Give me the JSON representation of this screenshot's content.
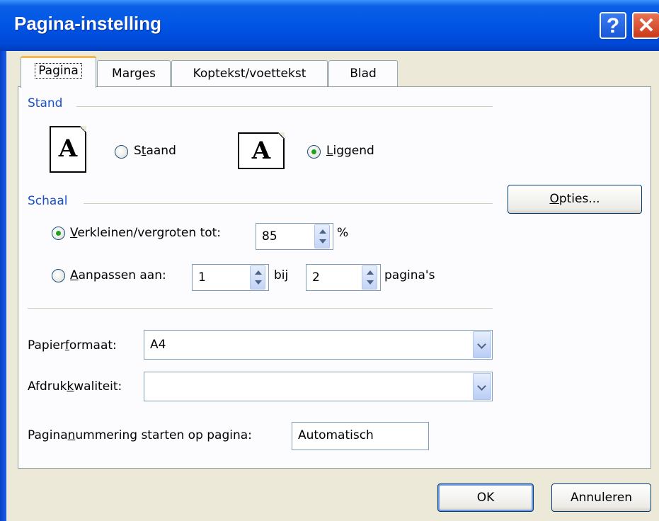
{
  "window": {
    "title": "Pagina-instelling",
    "help_glyph": "?",
    "close_glyph": "✕"
  },
  "tabs": [
    {
      "label": "Pagina",
      "active": true
    },
    {
      "label": "Marges"
    },
    {
      "label": "Koptekst/voettekst"
    },
    {
      "label": "Blad"
    }
  ],
  "stand": {
    "group_label": "Stand",
    "icon_letter": "A",
    "portrait": {
      "pre": "S",
      "u": "t",
      "post": "aand",
      "selected": false
    },
    "landscape": {
      "pre": "",
      "u": "L",
      "post": "iggend",
      "selected": true
    }
  },
  "schaal": {
    "group_label": "Schaal",
    "adjust": {
      "pre": "",
      "u": "V",
      "post": "erkleinen/vergroten tot:",
      "value": "85",
      "unit": "%",
      "selected": true
    },
    "fit": {
      "pre": "",
      "u": "A",
      "post": "anpassen aan:",
      "wide": "1",
      "bij": "bij",
      "tall": "2",
      "unit": "pagina's",
      "selected": false
    }
  },
  "options_button": {
    "pre": "",
    "u": "O",
    "post": "pties..."
  },
  "paper": {
    "pre": "Papier",
    "u": "f",
    "post": "ormaat:",
    "value": "A4"
  },
  "quality": {
    "pre": "Afdruk",
    "u": "k",
    "post": "waliteit:",
    "value": ""
  },
  "first_page": {
    "pre": "Pagina",
    "u": "n",
    "post": "ummering starten op pagina:",
    "value": "Automatisch"
  },
  "buttons": {
    "ok": "OK",
    "cancel": "Annuleren"
  }
}
